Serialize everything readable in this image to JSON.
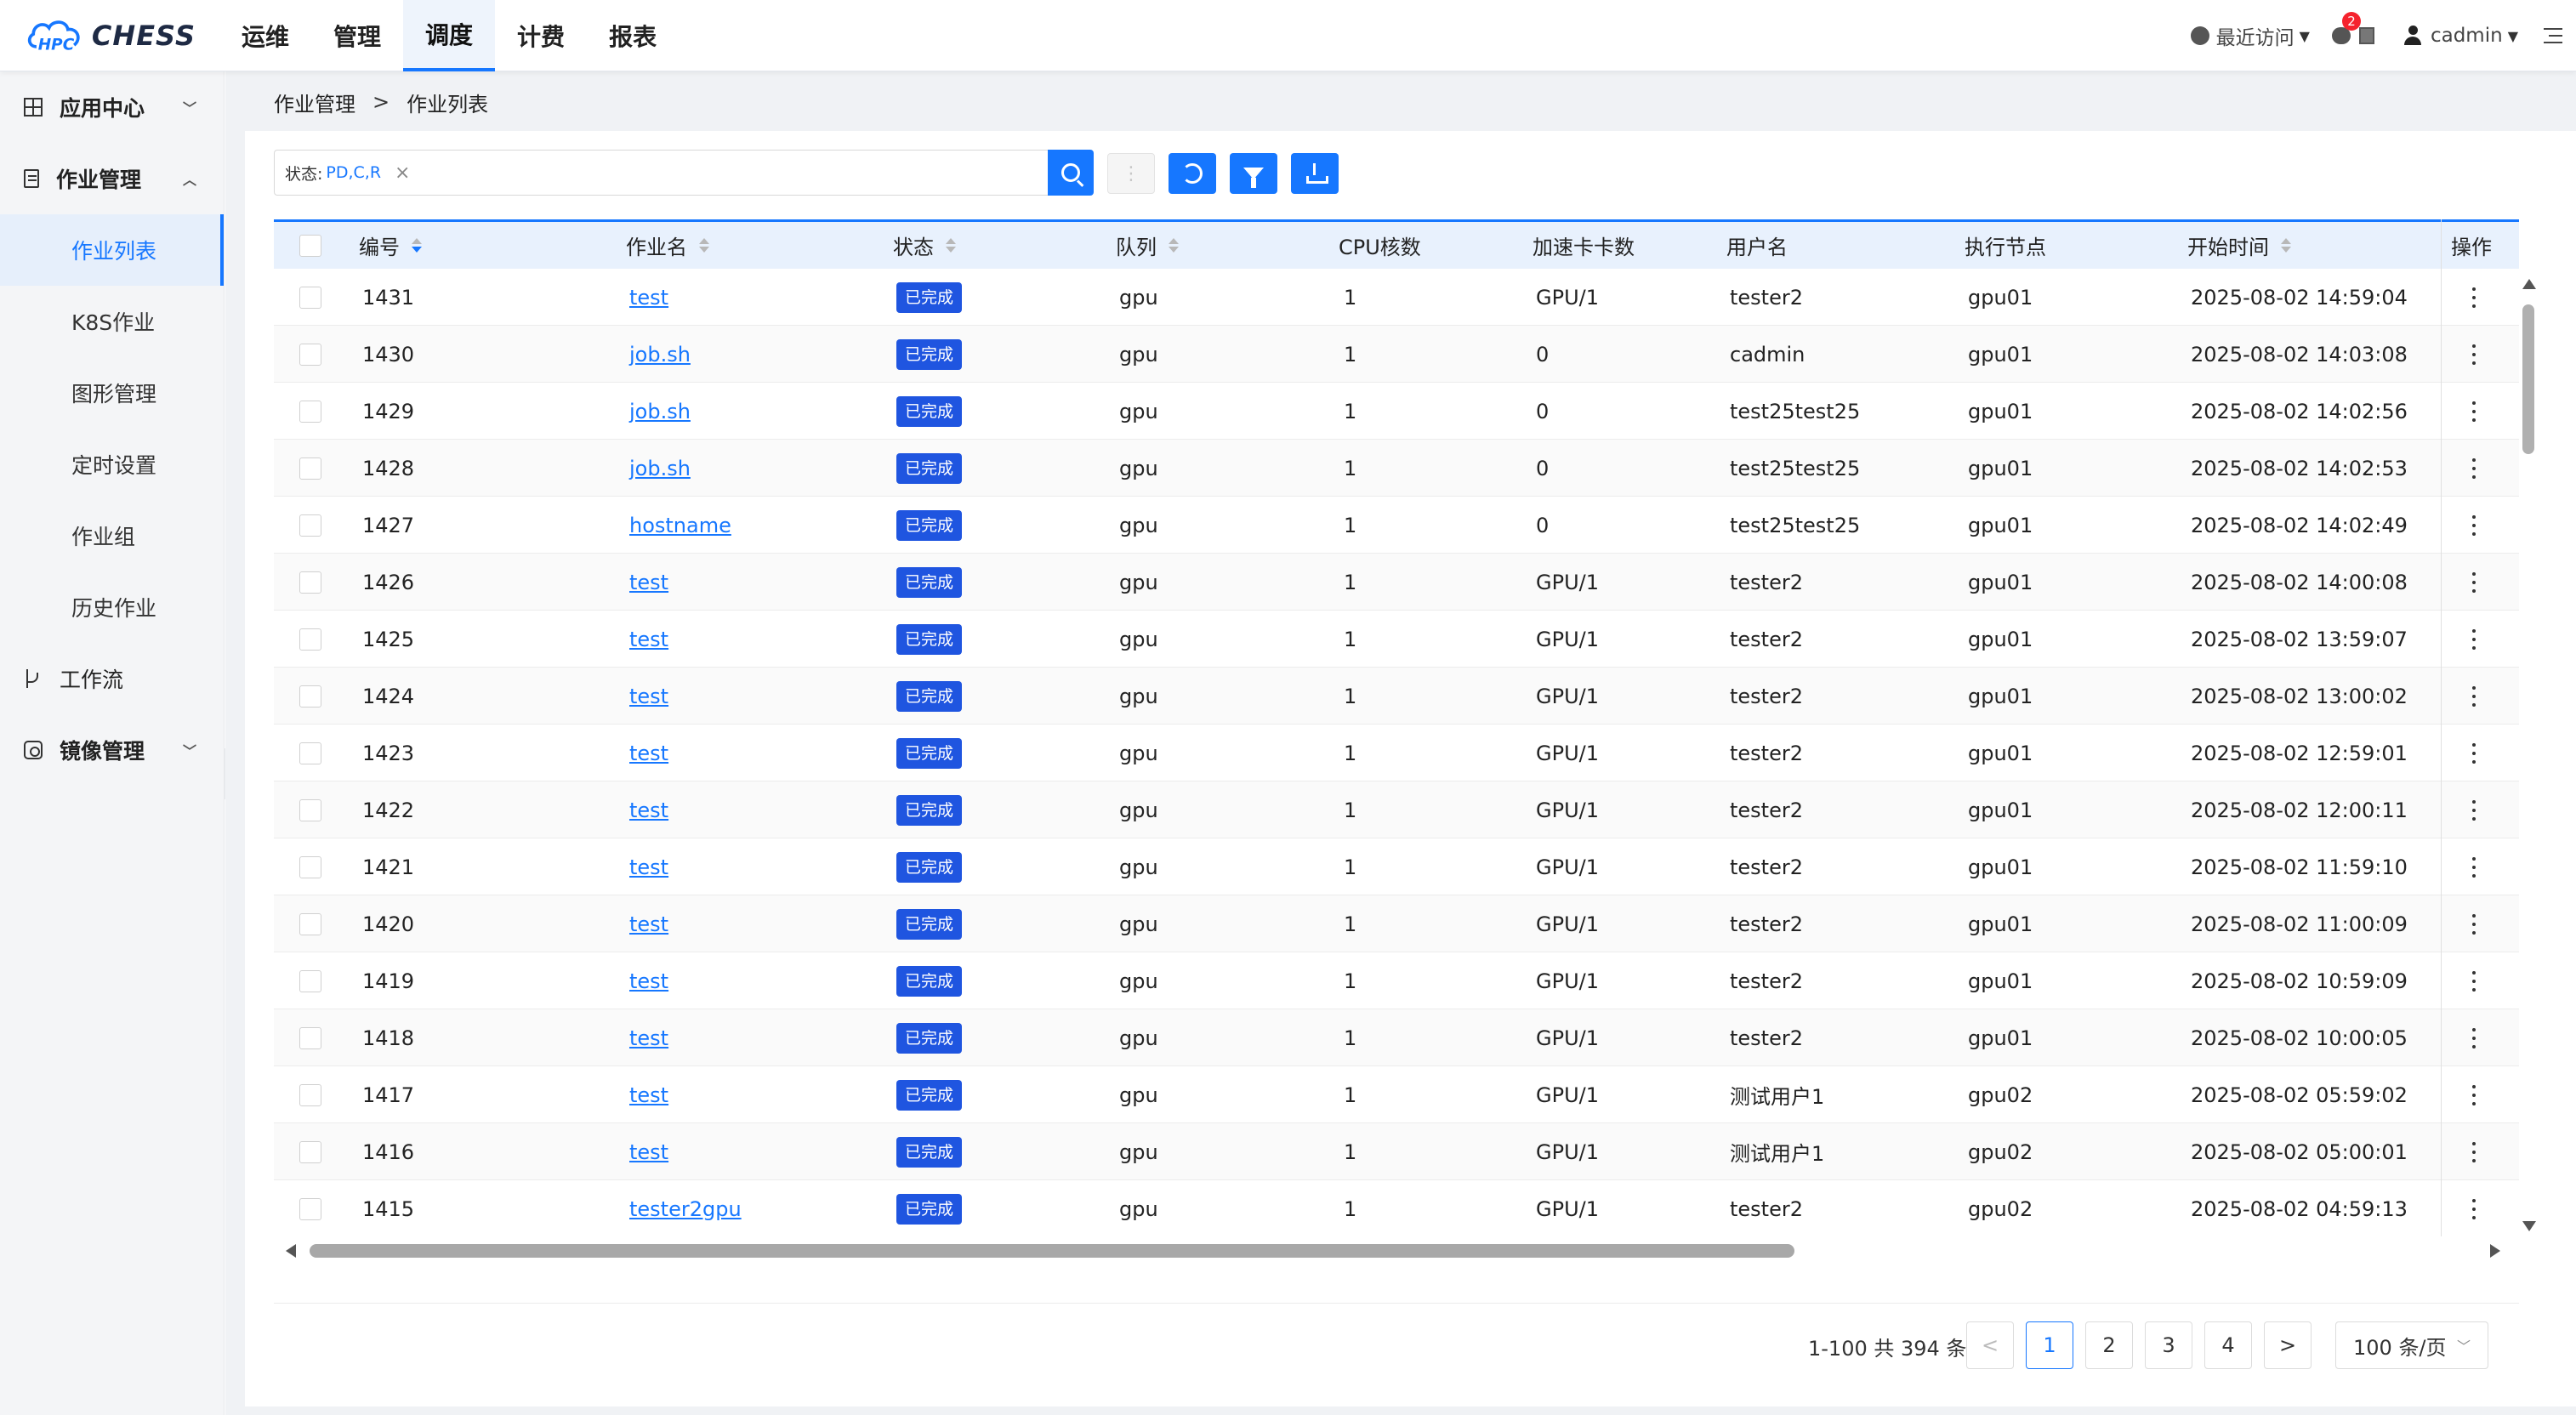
{
  "brand": {
    "name": "CHESS",
    "logo_letters": "HPC"
  },
  "topnav": [
    {
      "label": "运维",
      "active": false
    },
    {
      "label": "管理",
      "active": false
    },
    {
      "label": "调度",
      "active": true
    },
    {
      "label": "计费",
      "active": false
    },
    {
      "label": "报表",
      "active": false
    }
  ],
  "header_right": {
    "recent_label": "最近访问",
    "notification_count": "2",
    "username": "cadmin"
  },
  "sidebar": {
    "app_center": "应用中心",
    "job_mgmt": "作业管理",
    "sub_items": [
      "作业列表",
      "K8S作业",
      "图形管理",
      "定时设置",
      "作业组",
      "历史作业"
    ],
    "workflow": "工作流",
    "image_mgmt": "镜像管理"
  },
  "breadcrumb": {
    "parent": "作业管理",
    "current": "作业列表"
  },
  "filter": {
    "label": "状态:",
    "value": "PD,C,R",
    "close": "×"
  },
  "toolbar": {
    "disabled_glyph": "⋮"
  },
  "table": {
    "columns": [
      "编号",
      "作业名",
      "状态",
      "队列",
      "CPU核数",
      "加速卡卡数",
      "用户名",
      "执行节点",
      "开始时间",
      "操作"
    ],
    "rows": [
      {
        "id": "1431",
        "name": "test",
        "status": "已完成",
        "queue": "gpu",
        "cpu": "1",
        "accel": "GPU/1",
        "user": "tester2",
        "node": "gpu01",
        "start": "2025-08-02 14:59:04"
      },
      {
        "id": "1430",
        "name": "job.sh",
        "status": "已完成",
        "queue": "gpu",
        "cpu": "1",
        "accel": "0",
        "user": "cadmin",
        "node": "gpu01",
        "start": "2025-08-02 14:03:08"
      },
      {
        "id": "1429",
        "name": "job.sh",
        "status": "已完成",
        "queue": "gpu",
        "cpu": "1",
        "accel": "0",
        "user": "test25test25",
        "node": "gpu01",
        "start": "2025-08-02 14:02:56"
      },
      {
        "id": "1428",
        "name": "job.sh",
        "status": "已完成",
        "queue": "gpu",
        "cpu": "1",
        "accel": "0",
        "user": "test25test25",
        "node": "gpu01",
        "start": "2025-08-02 14:02:53"
      },
      {
        "id": "1427",
        "name": "hostname",
        "status": "已完成",
        "queue": "gpu",
        "cpu": "1",
        "accel": "0",
        "user": "test25test25",
        "node": "gpu01",
        "start": "2025-08-02 14:02:49"
      },
      {
        "id": "1426",
        "name": "test",
        "status": "已完成",
        "queue": "gpu",
        "cpu": "1",
        "accel": "GPU/1",
        "user": "tester2",
        "node": "gpu01",
        "start": "2025-08-02 14:00:08"
      },
      {
        "id": "1425",
        "name": "test",
        "status": "已完成",
        "queue": "gpu",
        "cpu": "1",
        "accel": "GPU/1",
        "user": "tester2",
        "node": "gpu01",
        "start": "2025-08-02 13:59:07"
      },
      {
        "id": "1424",
        "name": "test",
        "status": "已完成",
        "queue": "gpu",
        "cpu": "1",
        "accel": "GPU/1",
        "user": "tester2",
        "node": "gpu01",
        "start": "2025-08-02 13:00:02"
      },
      {
        "id": "1423",
        "name": "test",
        "status": "已完成",
        "queue": "gpu",
        "cpu": "1",
        "accel": "GPU/1",
        "user": "tester2",
        "node": "gpu01",
        "start": "2025-08-02 12:59:01"
      },
      {
        "id": "1422",
        "name": "test",
        "status": "已完成",
        "queue": "gpu",
        "cpu": "1",
        "accel": "GPU/1",
        "user": "tester2",
        "node": "gpu01",
        "start": "2025-08-02 12:00:11"
      },
      {
        "id": "1421",
        "name": "test",
        "status": "已完成",
        "queue": "gpu",
        "cpu": "1",
        "accel": "GPU/1",
        "user": "tester2",
        "node": "gpu01",
        "start": "2025-08-02 11:59:10"
      },
      {
        "id": "1420",
        "name": "test",
        "status": "已完成",
        "queue": "gpu",
        "cpu": "1",
        "accel": "GPU/1",
        "user": "tester2",
        "node": "gpu01",
        "start": "2025-08-02 11:00:09"
      },
      {
        "id": "1419",
        "name": "test",
        "status": "已完成",
        "queue": "gpu",
        "cpu": "1",
        "accel": "GPU/1",
        "user": "tester2",
        "node": "gpu01",
        "start": "2025-08-02 10:59:09"
      },
      {
        "id": "1418",
        "name": "test",
        "status": "已完成",
        "queue": "gpu",
        "cpu": "1",
        "accel": "GPU/1",
        "user": "tester2",
        "node": "gpu01",
        "start": "2025-08-02 10:00:05"
      },
      {
        "id": "1417",
        "name": "test",
        "status": "已完成",
        "queue": "gpu",
        "cpu": "1",
        "accel": "GPU/1",
        "user": "测试用户1",
        "node": "gpu02",
        "start": "2025-08-02 05:59:02"
      },
      {
        "id": "1416",
        "name": "test",
        "status": "已完成",
        "queue": "gpu",
        "cpu": "1",
        "accel": "GPU/1",
        "user": "测试用户1",
        "node": "gpu02",
        "start": "2025-08-02 05:00:01"
      },
      {
        "id": "1415",
        "name": "tester2gpu",
        "status": "已完成",
        "queue": "gpu",
        "cpu": "1",
        "accel": "GPU/1",
        "user": "tester2",
        "node": "gpu02",
        "start": "2025-08-02 04:59:13"
      }
    ]
  },
  "pagination": {
    "total_text": "1-100 共 394 条",
    "pages": [
      "1",
      "2",
      "3",
      "4"
    ],
    "current_page": "1",
    "prev": "<",
    "next": ">",
    "page_size": "100 条/页"
  },
  "colors": {
    "primary": "#1677ff",
    "status_done": "#1f55e0"
  }
}
